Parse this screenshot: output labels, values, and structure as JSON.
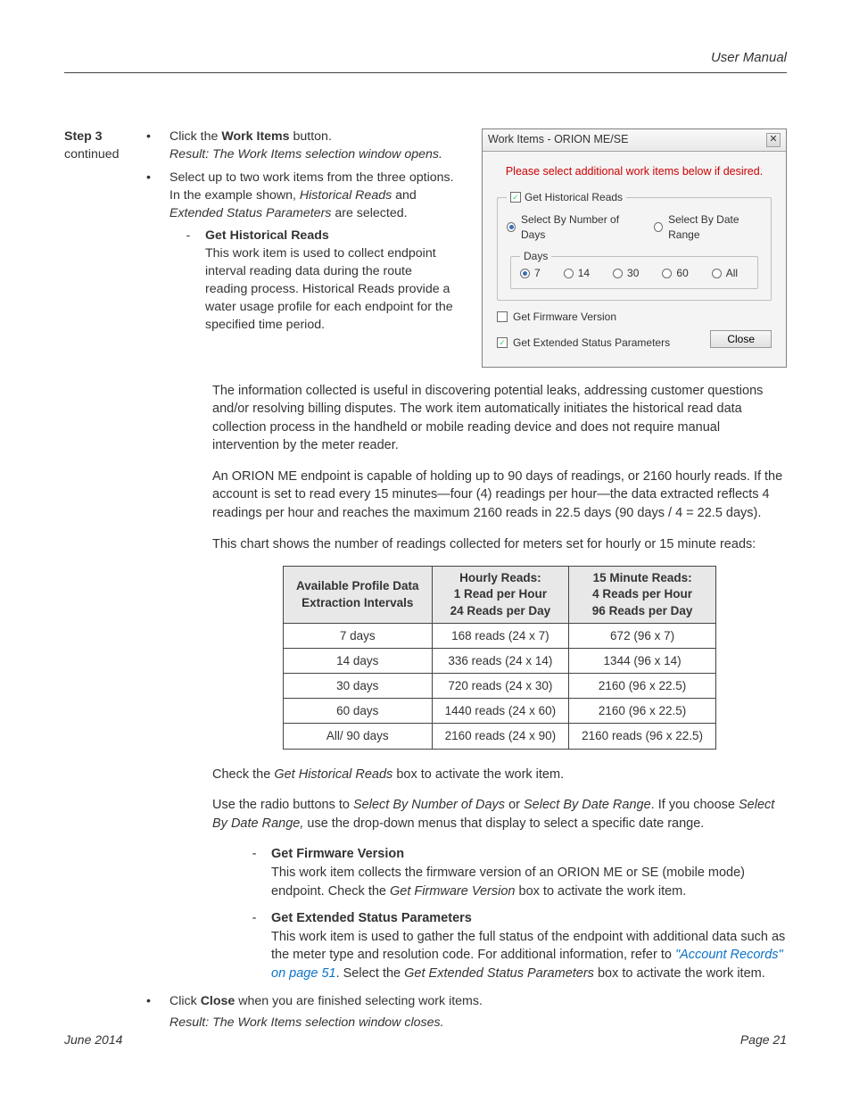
{
  "header": {
    "title": "User Manual"
  },
  "footer": {
    "date": "June 2014",
    "page": "Page 21"
  },
  "step": {
    "label": "Step 3",
    "cont": "continued"
  },
  "topBullets": {
    "b1_pre": "Click the ",
    "b1_bold": "Work Items",
    "b1_post": " button.",
    "b1_result": "Result: The Work Items selection window opens.",
    "b2_pre": "Select up to two work items from the three options. In the example shown, ",
    "b2_i1": "Historical Reads",
    "b2_mid": " and ",
    "b2_i2": "Extended Status Parameters",
    "b2_post": " are selected."
  },
  "ghr": {
    "title": "Get Historical Reads",
    "desc": "This work item is used to collect endpoint interval reading data during the route reading process. Historical Reads provide a water usage profile for each endpoint for the specified time period."
  },
  "dialog": {
    "title": "Work Items - ORION ME/SE",
    "msg": "Please select additional work items below if desired.",
    "ghr_label": "Get Historical Reads",
    "opt_num": "Select By Number of Days",
    "opt_range": "Select By Date Range",
    "days_label": "Days",
    "d7": "7",
    "d14": "14",
    "d30": "30",
    "d60": "60",
    "dall": "All",
    "gfv_label": "Get Firmware Version",
    "gesp_label": "Get Extended Status Parameters",
    "close": "Close"
  },
  "paras": {
    "p1": "The information collected is useful in discovering potential leaks, addressing customer questions and/or resolving billing disputes. The work item automatically initiates the historical read data collection process in the handheld or mobile reading device and does not require manual intervention by the meter reader.",
    "p2": "An ORION ME endpoint is capable of holding up to 90 days of readings, or 2160 hourly reads. If the account is set to read every 15 minutes—four (4) readings per hour—the data extracted reflects 4 readings per hour and reaches the maximum 2160 reads in 22.5 days (90 days / 4 = 22.5 days).",
    "p3": "This chart shows the number of readings collected for meters set for hourly or 15 minute reads:"
  },
  "chart_data": {
    "type": "table",
    "headers": {
      "c1a": "Available Profile Data",
      "c1b": "Extraction Intervals",
      "c2a": "Hourly Reads:",
      "c2b": "1 Read per Hour",
      "c2c": "24 Reads per Day",
      "c3a": "15 Minute Reads:",
      "c3b": "4 Reads per Hour",
      "c3c": "96 Reads per Day"
    },
    "rows": [
      {
        "c1": "7 days",
        "c2": "168 reads (24 x 7)",
        "c3": "672 (96 x 7)"
      },
      {
        "c1": "14 days",
        "c2": "336 reads (24 x 14)",
        "c3": "1344 (96 x 14)"
      },
      {
        "c1": "30 days",
        "c2": "720 reads (24 x 30)",
        "c3": "2160 (96 x 22.5)"
      },
      {
        "c1": "60 days",
        "c2": "1440 reads (24 x 60)",
        "c3": "2160 (96 x 22.5)"
      },
      {
        "c1": "All/ 90 days",
        "c2": "2160 reads (24 x 90)",
        "c3": "2160 reads (96 x 22.5)"
      }
    ]
  },
  "postTable": {
    "check_pre": "Check the ",
    "check_i": "Get Historical Reads",
    "check_post": " box to activate the work item.",
    "radio_p1": "Use the radio buttons to ",
    "radio_i1": "Select By Number of Days",
    "radio_mid1": " or ",
    "radio_i2": "Select By Date Range",
    "radio_mid2": ". If you choose ",
    "radio_i3": "Select By Date Range,",
    "radio_post": " use the drop-down menus that display to select a specific date range."
  },
  "gfv": {
    "title": "Get Firmware Version",
    "desc_pre": "This work item collects the firmware version of an ORION ME or SE (mobile mode) endpoint. Check the ",
    "desc_i": "Get Firmware Version",
    "desc_post": " box to activate the work item."
  },
  "gesp": {
    "title": "Get Extended Status Parameters",
    "desc_pre": "This work item is used to gather the full status of the endpoint with additional data such as the meter type and resolution code. For additional information, refer to ",
    "link": "\"Account Records\" on page 51",
    "desc_mid": ". Select the ",
    "desc_i": "Get Extended Status Parameters",
    "desc_post": " box to activate the work item."
  },
  "lastBullets": {
    "b1_pre": "Click ",
    "b1_bold": "Close",
    "b1_post": " when you are finished selecting work items.",
    "b1_result": "Result: The Work Items selection window closes."
  }
}
